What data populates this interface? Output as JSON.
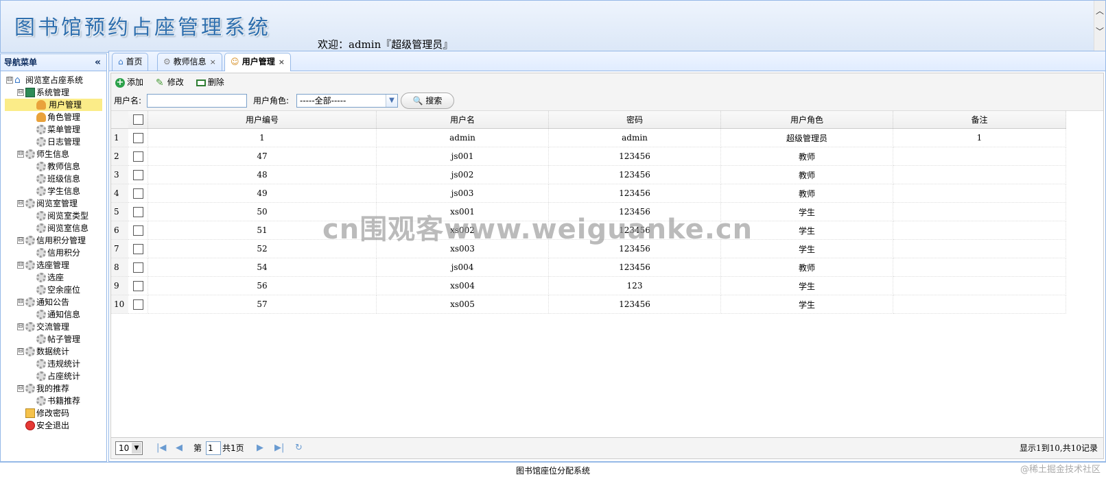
{
  "header": {
    "title": "图书馆预约占座管理系统",
    "welcome": "欢迎：admin『超级管理员』",
    "scroll_up": "︿",
    "scroll_down": "﹀"
  },
  "nav": {
    "title": "导航菜单",
    "collapse": "«",
    "items": [
      {
        "label": "阅览室占座系统",
        "level": 0,
        "toggle": "⊟",
        "icon": "home-icon"
      },
      {
        "label": "系统管理",
        "level": 1,
        "toggle": "⊟",
        "icon": "book-icon"
      },
      {
        "label": "用户管理",
        "level": 2,
        "icon": "user-icon",
        "selected": true
      },
      {
        "label": "角色管理",
        "level": 2,
        "icon": "role-icon"
      },
      {
        "label": "菜单管理",
        "level": 2,
        "icon": "menu-icon"
      },
      {
        "label": "日志管理",
        "level": 2,
        "icon": "gear-icon"
      },
      {
        "label": "师生信息",
        "level": 1,
        "toggle": "⊟",
        "icon": "gear-icon"
      },
      {
        "label": "教师信息",
        "level": 2,
        "icon": "gear-icon"
      },
      {
        "label": "班级信息",
        "level": 2,
        "icon": "gear-icon"
      },
      {
        "label": "学生信息",
        "level": 2,
        "icon": "gear-icon"
      },
      {
        "label": "阅览室管理",
        "level": 1,
        "toggle": "⊟",
        "icon": "gear-icon"
      },
      {
        "label": "阅览室类型",
        "level": 2,
        "icon": "gear-icon"
      },
      {
        "label": "阅览室信息",
        "level": 2,
        "icon": "gear-icon"
      },
      {
        "label": "信用积分管理",
        "level": 1,
        "toggle": "⊟",
        "icon": "gear-icon"
      },
      {
        "label": "信用积分",
        "level": 2,
        "icon": "gear-icon"
      },
      {
        "label": "选座管理",
        "level": 1,
        "toggle": "⊟",
        "icon": "gear-icon"
      },
      {
        "label": "选座",
        "level": 2,
        "icon": "gear-icon"
      },
      {
        "label": "空余座位",
        "level": 2,
        "icon": "gear-icon"
      },
      {
        "label": "通知公告",
        "level": 1,
        "toggle": "⊟",
        "icon": "gear-icon"
      },
      {
        "label": "通知信息",
        "level": 2,
        "icon": "gear-icon"
      },
      {
        "label": "交流管理",
        "level": 1,
        "toggle": "⊟",
        "icon": "gear-icon"
      },
      {
        "label": "帖子管理",
        "level": 2,
        "icon": "gear-icon"
      },
      {
        "label": "数据统计",
        "level": 1,
        "toggle": "⊟",
        "icon": "gear-icon"
      },
      {
        "label": "违规统计",
        "level": 2,
        "icon": "gear-icon"
      },
      {
        "label": "占座统计",
        "level": 2,
        "icon": "gear-icon"
      },
      {
        "label": "我的推荐",
        "level": 1,
        "toggle": "⊟",
        "icon": "gear-icon"
      },
      {
        "label": "书籍推荐",
        "level": 2,
        "icon": "gear-icon"
      },
      {
        "label": "修改密码",
        "level": 1,
        "icon": "lock-icon"
      },
      {
        "label": "安全退出",
        "level": 1,
        "icon": "exit-icon"
      }
    ]
  },
  "tabs": [
    {
      "label": "首页",
      "closable": false,
      "icon": "home-icon"
    },
    {
      "label": "教师信息",
      "closable": true,
      "icon": "gear-icon"
    },
    {
      "label": "用户管理",
      "closable": true,
      "icon": "user-icon",
      "active": true
    }
  ],
  "tab_close": "×",
  "toolbar": {
    "add": "添加",
    "edit": "修改",
    "delete": "删除"
  },
  "search": {
    "username_label": "用户名:",
    "username_value": "",
    "role_label": "用户角色:",
    "role_selected": "-----全部-----",
    "search_button": "搜索"
  },
  "grid": {
    "columns": [
      "用户编号",
      "用户名",
      "密码",
      "用户角色",
      "备注"
    ],
    "rows": [
      [
        "1",
        "admin",
        "admin",
        "超级管理员",
        "1"
      ],
      [
        "47",
        "js001",
        "123456",
        "教师",
        ""
      ],
      [
        "48",
        "js002",
        "123456",
        "教师",
        ""
      ],
      [
        "49",
        "js003",
        "123456",
        "教师",
        ""
      ],
      [
        "50",
        "xs001",
        "123456",
        "学生",
        ""
      ],
      [
        "51",
        "xs002",
        "123456",
        "学生",
        ""
      ],
      [
        "52",
        "xs003",
        "123456",
        "学生",
        ""
      ],
      [
        "54",
        "js004",
        "123456",
        "教师",
        ""
      ],
      [
        "56",
        "xs004",
        "123",
        "学生",
        ""
      ],
      [
        "57",
        "xs005",
        "123456",
        "学生",
        ""
      ]
    ]
  },
  "pager": {
    "page_size": "10",
    "page_prefix": "第",
    "page_value": "1",
    "page_total": "共1页",
    "info": "显示1到10,共10记录",
    "first": "|◀",
    "prev": "◀",
    "next": "▶",
    "last": "▶|",
    "refresh": "↻"
  },
  "footer": {
    "text": "图书馆座位分配系统"
  },
  "watermarks": {
    "center": "cn围观客www.weiguanke.cn",
    "corner": "@稀土掘金技术社区"
  }
}
